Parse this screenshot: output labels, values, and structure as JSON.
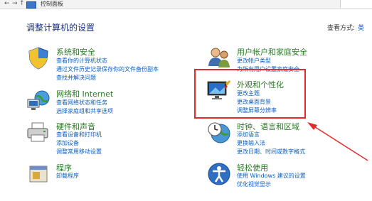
{
  "window": {
    "breadcrumb": "控制面板"
  },
  "page": {
    "title": "调整计算机的设置",
    "view_by_label": "查看方式:",
    "view_by_value": "类"
  },
  "categories": {
    "system_security": {
      "title": "系统和安全",
      "links": [
        "查看你的计算机状态",
        "通过文件历史记录保存你的文件备份副本",
        "查找并解决问题"
      ]
    },
    "network": {
      "title": "网络和 Internet",
      "links": [
        "查看网络状态和任务",
        "选择家庭组和共享选项"
      ]
    },
    "hardware": {
      "title": "硬件和声音",
      "links": [
        "查看设备和打印机",
        "添加设备",
        "调整常用移动设置"
      ]
    },
    "programs": {
      "title": "程序",
      "links": [
        "卸载程序"
      ]
    },
    "user_accounts": {
      "title": "用户帐户和家庭安全",
      "links": [
        "更改帐户类型",
        "为所有用户设置家庭安全"
      ]
    },
    "appearance": {
      "title": "外观和个性化",
      "links": [
        "更改主题",
        "更改桌面背景",
        "调整屏幕分辨率"
      ]
    },
    "clock": {
      "title": "时钟、语言和区域",
      "links": [
        "添加语言",
        "更换输入法",
        "更改日期、时间或数字格式"
      ]
    },
    "ease": {
      "title": "轻松使用",
      "links": [
        "使用 Windows 建议的设置",
        "优化视觉显示"
      ]
    }
  },
  "colors": {
    "title_green": "#2a7a24",
    "link_blue": "#0b5fbf",
    "annotation_red": "#e32b2b"
  }
}
